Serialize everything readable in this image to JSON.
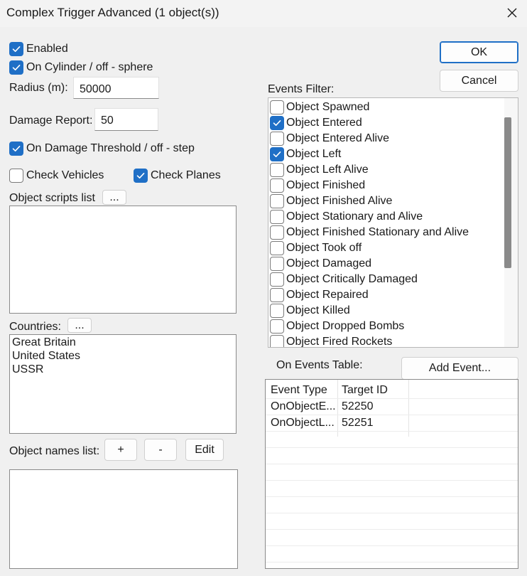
{
  "window": {
    "title": "Complex Trigger Advanced (1 object(s))"
  },
  "checkboxes": {
    "enabled": {
      "label": "Enabled",
      "checked": true
    },
    "on_cylinder": {
      "label": "On Cylinder / off - sphere",
      "checked": true
    },
    "on_damage_threshold": {
      "label": "On Damage Threshold / off - step",
      "checked": true
    },
    "check_vehicles": {
      "label": "Check Vehicles",
      "checked": false
    },
    "check_planes": {
      "label": "Check Planes",
      "checked": true
    }
  },
  "radius": {
    "label": "Radius (m):",
    "value": "50000"
  },
  "damage_report": {
    "label": "Damage Report:",
    "value": "50"
  },
  "object_scripts": {
    "label": "Object scripts list",
    "button": "...",
    "items": []
  },
  "countries": {
    "label": "Countries:",
    "button": "...",
    "items": [
      "Great Britain",
      "United States",
      "USSR"
    ]
  },
  "object_names": {
    "label": "Object names list:",
    "add": "+",
    "remove": "-",
    "edit": "Edit",
    "items": []
  },
  "dialog_buttons": {
    "ok": "OK",
    "cancel": "Cancel"
  },
  "events_filter": {
    "label": "Events Filter:",
    "items": [
      {
        "label": "Object Spawned",
        "checked": false
      },
      {
        "label": "Object Entered",
        "checked": true
      },
      {
        "label": "Object Entered Alive",
        "checked": false
      },
      {
        "label": "Object Left",
        "checked": true
      },
      {
        "label": "Object Left Alive",
        "checked": false
      },
      {
        "label": "Object Finished",
        "checked": false
      },
      {
        "label": "Object Finished Alive",
        "checked": false
      },
      {
        "label": "Object Stationary and Alive",
        "checked": false
      },
      {
        "label": "Object Finished Stationary and Alive",
        "checked": false
      },
      {
        "label": "Object Took off",
        "checked": false
      },
      {
        "label": "Object Damaged",
        "checked": false
      },
      {
        "label": "Object Critically Damaged",
        "checked": false
      },
      {
        "label": "Object Repaired",
        "checked": false
      },
      {
        "label": "Object Killed",
        "checked": false
      },
      {
        "label": "Object Dropped Bombs",
        "checked": false
      },
      {
        "label": "Object Fired Rockets",
        "checked": false
      }
    ]
  },
  "events_table": {
    "label": "On Events Table:",
    "add_button": "Add Event...",
    "columns": [
      "Event Type",
      "Target ID"
    ],
    "rows": [
      [
        "OnObjectE...",
        "52250"
      ],
      [
        "OnObjectL...",
        "52251"
      ]
    ]
  }
}
